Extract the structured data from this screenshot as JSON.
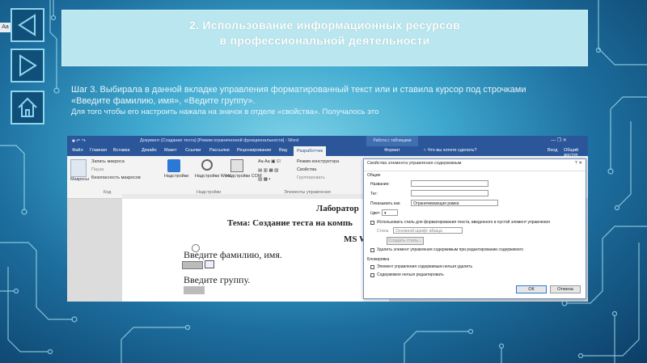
{
  "slide": {
    "font_badge": "Aa",
    "title_line1": "2. Использование информационных ресурсов",
    "title_line2": "в профессиональной деятельности",
    "step_line1": "Шаг 3. Выбирала в данной вкладке управления форматированный текст или и ставила курсор под строчками",
    "step_line2": "«Введите фамилию, имя», «Ведите группу».",
    "step_line3": "Для того чтобы его настроить нажала на значок в отделе «свойства». Получалось это"
  },
  "nav": {
    "back_icon": "triangle-left-icon",
    "forward_icon": "triangle-right-icon",
    "home_icon": "home-icon"
  },
  "word": {
    "window_title": "Документ (Создание теста) [Режим ограниченной функциональности] - Word",
    "context_tab_group": "Работа с таблицами",
    "tabs": [
      "Файл",
      "Главная",
      "Вставка",
      "Дизайн",
      "Макет",
      "Ссылки",
      "Рассылки",
      "Рецензирование",
      "Вид",
      "Разработчик",
      "Формат"
    ],
    "tell_me": "Что вы хотите сделать?",
    "user": "Вход",
    "share": "Общий доступ",
    "ribbon": {
      "record_macro": "Запись макроса",
      "pause": "Пауза",
      "macro_security": "Безопасность макросов",
      "macros": "Макросы",
      "code_group": "Код",
      "addins": "Надстройки",
      "word_addins": "Надстройки Word",
      "com_addins": "Надстройки COM",
      "addins_group": "Надстройки",
      "design_mode": "Режим конструктора",
      "properties": "Свойства",
      "group": "Группировать",
      "controls_group": "Элементы управления"
    },
    "doc": {
      "heading1": "Лаборатор",
      "heading2": "Тема: Создание теста на компь",
      "heading3": "MS W",
      "line_name": "Введите фамилию, имя.",
      "line_group": "Введите группу."
    },
    "dialog": {
      "title": "Свойства элемента управления содержимым",
      "section_general": "Общие",
      "label_name": "Название:",
      "label_tag": "Тег:",
      "label_show_as": "Показывать как:",
      "show_as_value": "Ограничивающая рамка",
      "label_color": "Цвет:",
      "use_style": "Использовать стиль для форматирования текста, введенного в пустой элемент управления",
      "label_style": "Стиль:",
      "style_value": "Основной шрифт абзаца",
      "new_style": "Создать стиль...",
      "remove_when_edited": "Удалить элемент управления содержимым при редактировании содержимого",
      "section_lock": "Блокировка",
      "lock_delete": "Элемент управления содержимым нельзя удалить",
      "lock_edit": "Содержимое нельзя редактировать",
      "ok": "ОК",
      "cancel": "Отмена"
    }
  },
  "colors": {
    "word_blue": "#2b578a",
    "title_box": "#b9e6ef",
    "nav_button": "#0f4f7a"
  }
}
